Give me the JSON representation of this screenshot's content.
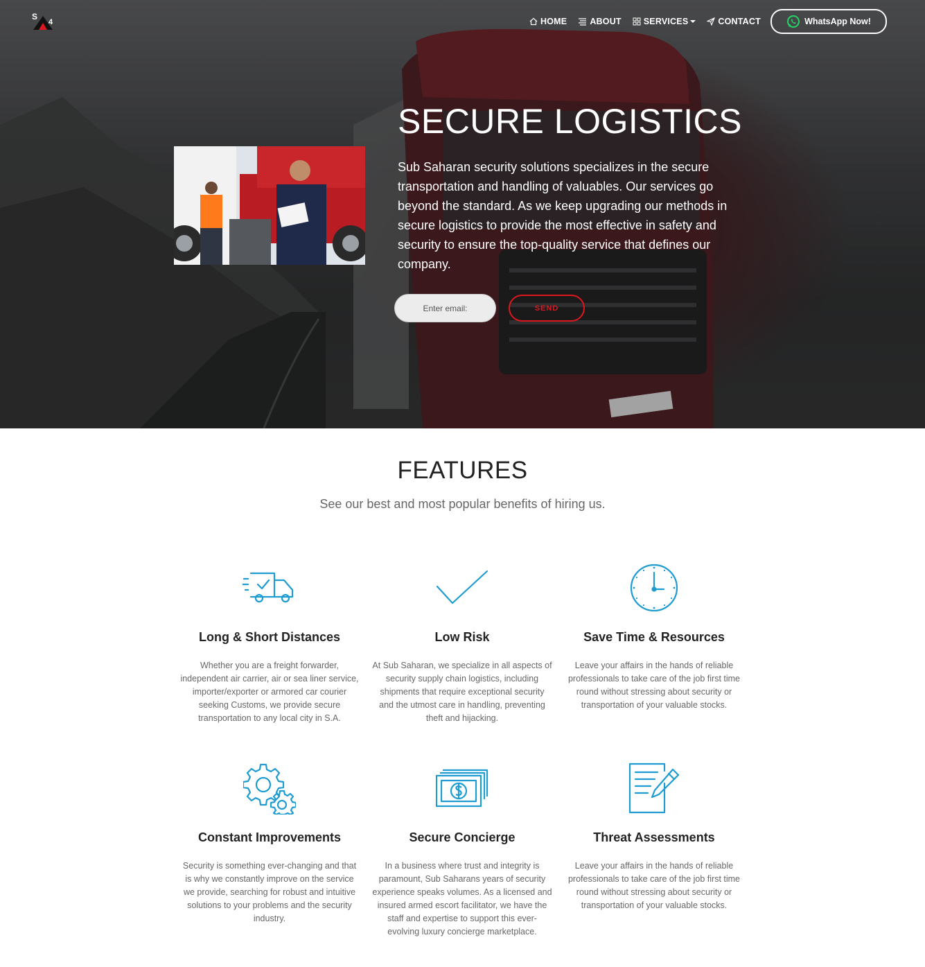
{
  "nav": {
    "items": [
      {
        "label": "HOME",
        "icon": "home-icon"
      },
      {
        "label": "ABOUT",
        "icon": "list-icon"
      },
      {
        "label": "SERVICES",
        "icon": "grid-icon"
      },
      {
        "label": "CONTACT",
        "icon": "send-icon"
      }
    ],
    "whatsapp_label": "WhatsApp Now!"
  },
  "hero": {
    "title": "SECURE LOGISTICS",
    "text": "Sub Saharan security solutions specializes in the secure transportation and handling of valuables. Our services go beyond the standard. As we keep upgrading our methods in secure logistics to provide the most effective in safety and security to ensure the top-quality service that defines our company.",
    "email_placeholder": "Enter email:",
    "send_label": "SEND"
  },
  "features": {
    "title": "FEATURES",
    "subtitle": "See our best and most popular benefits of hiring us.",
    "items": [
      {
        "icon": "delivery-truck-icon",
        "title": "Long & Short Distances",
        "text": "Whether you are a freight forwarder, independent air carrier, air or sea liner service, importer/exporter or armored car courier seeking Customs, we provide secure transportation to any local city in S.A."
      },
      {
        "icon": "checkmark-icon",
        "title": "Low Risk",
        "text": "At Sub Saharan, we specialize in all aspects of security supply chain logistics, including shipments that require exceptional security and the utmost care in handling, preventing theft and hijacking."
      },
      {
        "icon": "clock-icon",
        "title": "Save Time & Resources",
        "text": "Leave your affairs in the hands of reliable professionals to take care of the job first time round without stressing about security or transportation of your valuable stocks."
      },
      {
        "icon": "gears-icon",
        "title": "Constant Improvements",
        "text": "Security is something ever-changing and that is why we constantly improve on the service we provide, searching for robust and intuitive solutions to your problems and the security industry."
      },
      {
        "icon": "money-stack-icon",
        "title": "Secure Concierge",
        "text": "In a business where trust and integrity is paramount, Sub Saharans years of security experience speaks volumes. As a licensed and insured armed escort facilitator, we have the staff and expertise to support this ever-evolving luxury concierge marketplace."
      },
      {
        "icon": "document-edit-icon",
        "title": "Threat Assessments",
        "text": "Leave your affairs in the hands of reliable professionals to take care of the job first time round without stressing about security or transportation of your valuable stocks."
      }
    ]
  },
  "colors": {
    "accent": "#e0161e",
    "icon_blue": "#1e9bd1",
    "whatsapp_green": "#25d366"
  }
}
